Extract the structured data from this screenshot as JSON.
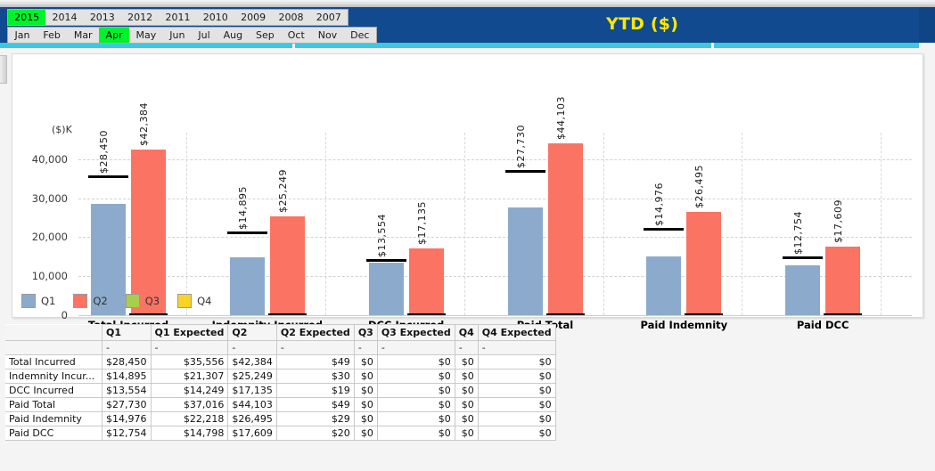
{
  "header": {
    "title": "YTD ($)",
    "title_color": "#ffe800",
    "bar_color": "#114a8e",
    "accent_color": "#3ec8e0"
  },
  "year_selector": {
    "items": [
      "2015",
      "2014",
      "2013",
      "2012",
      "2011",
      "2010",
      "2009",
      "2008",
      "2007"
    ],
    "active": "2015",
    "active_color": "#00f22a"
  },
  "month_selector": {
    "items": [
      "Jan",
      "Feb",
      "Mar",
      "Apr",
      "May",
      "Jun",
      "Jul",
      "Aug",
      "Sep",
      "Oct",
      "Nov",
      "Dec"
    ],
    "active": "Apr",
    "active_color": "#00f22a"
  },
  "chart_data": {
    "type": "bar",
    "title": "",
    "xlabel": "",
    "ylabel": "($)K",
    "ylim": [
      0,
      45000
    ],
    "yticks": [
      "0",
      "10,000",
      "20,000",
      "30,000",
      "40,000"
    ],
    "ytick_values": [
      0,
      10000,
      20000,
      30000,
      40000
    ],
    "grid": true,
    "legend_position": "bottom-left",
    "legend": [
      "Q1",
      "Q2",
      "Q3",
      "Q4"
    ],
    "series_colors": {
      "Q1": "#8cabcc",
      "Q2": "#fb7363",
      "Q3": "#a7ce4c",
      "Q4": "#fbd227",
      "expected_marker": "#000000"
    },
    "categories": [
      "Total Incurred",
      "Indemnity Incurred",
      "DCC Incurred",
      "Paid Total",
      "Paid Indemnity",
      "Paid DCC"
    ],
    "series": [
      {
        "name": "Q1",
        "values": [
          28450,
          14895,
          13554,
          27730,
          14976,
          12754
        ],
        "labels": [
          "$28,450",
          "$14,895",
          "$13,554",
          "$27,730",
          "$14,976",
          "$12,754"
        ]
      },
      {
        "name": "Q2",
        "values": [
          42384,
          25249,
          17135,
          44103,
          26495,
          17609
        ],
        "labels": [
          "$42,384",
          "$25,249",
          "$17,135",
          "$44,103",
          "$26,495",
          "$17,609"
        ]
      },
      {
        "name": "Q3",
        "values": [
          0,
          0,
          0,
          0,
          0,
          0
        ],
        "labels": [
          "$0",
          "$0",
          "$0",
          "$0",
          "$0",
          "$0"
        ]
      },
      {
        "name": "Q4",
        "values": [
          0,
          0,
          0,
          0,
          0,
          0
        ],
        "labels": [
          "$0",
          "$0",
          "$0",
          "$0",
          "$0",
          "$0"
        ]
      }
    ],
    "markers": [
      {
        "name": "Q1 Expected",
        "values": [
          35556,
          21307,
          14249,
          37016,
          22218,
          14798
        ]
      },
      {
        "name": "Q2 Expected",
        "values": [
          49,
          30,
          19,
          49,
          29,
          20
        ]
      }
    ]
  },
  "table": {
    "columns": [
      "",
      "Q1",
      "Q1 Expected",
      "Q2",
      "Q2 Expected",
      "Q3",
      "Q3 Expected",
      "Q4",
      "Q4 Expected"
    ],
    "subheader": [
      "",
      "-",
      "-",
      "-",
      "-",
      "-",
      "-",
      "-",
      "-"
    ],
    "rows": [
      {
        "label": "Total Incurred",
        "cells": [
          "$28,450",
          "$35,556",
          "$42,384",
          "$49",
          "$0",
          "$0",
          "$0",
          "$0"
        ]
      },
      {
        "label": "Indemnity Incur...",
        "cells": [
          "$14,895",
          "$21,307",
          "$25,249",
          "$30",
          "$0",
          "$0",
          "$0",
          "$0"
        ]
      },
      {
        "label": "DCC Incurred",
        "cells": [
          "$13,554",
          "$14,249",
          "$17,135",
          "$19",
          "$0",
          "$0",
          "$0",
          "$0"
        ]
      },
      {
        "label": "Paid Total",
        "cells": [
          "$27,730",
          "$37,016",
          "$44,103",
          "$49",
          "$0",
          "$0",
          "$0",
          "$0"
        ]
      },
      {
        "label": "Paid Indemnity",
        "cells": [
          "$14,976",
          "$22,218",
          "$26,495",
          "$29",
          "$0",
          "$0",
          "$0",
          "$0"
        ]
      },
      {
        "label": "Paid DCC",
        "cells": [
          "$12,754",
          "$14,798",
          "$17,609",
          "$20",
          "$0",
          "$0",
          "$0",
          "$0"
        ]
      }
    ]
  }
}
